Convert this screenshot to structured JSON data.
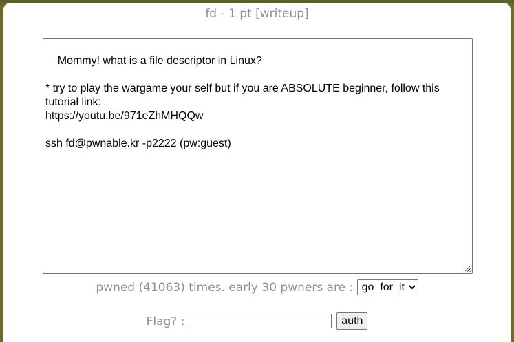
{
  "header": {
    "title": "fd - 1 pt [writeup]"
  },
  "challenge": {
    "description": "Mommy! what is a file descriptor in Linux?\n\n* try to play the wargame your self but if you are ABSOLUTE beginner, follow this tutorial link:\nhttps://youtu.be/971eZhMHQQw\n\nssh fd@pwnable.kr -p2222 (pw:guest)"
  },
  "stats": {
    "pwned_text": "pwned (41063) times. early 30 pwners are :",
    "selected_pwner": "go_for_it"
  },
  "flag_form": {
    "label": "Flag? :",
    "input_value": "",
    "submit_label": "auth"
  },
  "colors": {
    "background": "#6b6b2e",
    "panel": "#ffffff",
    "muted_text": "#8f8f8f"
  }
}
